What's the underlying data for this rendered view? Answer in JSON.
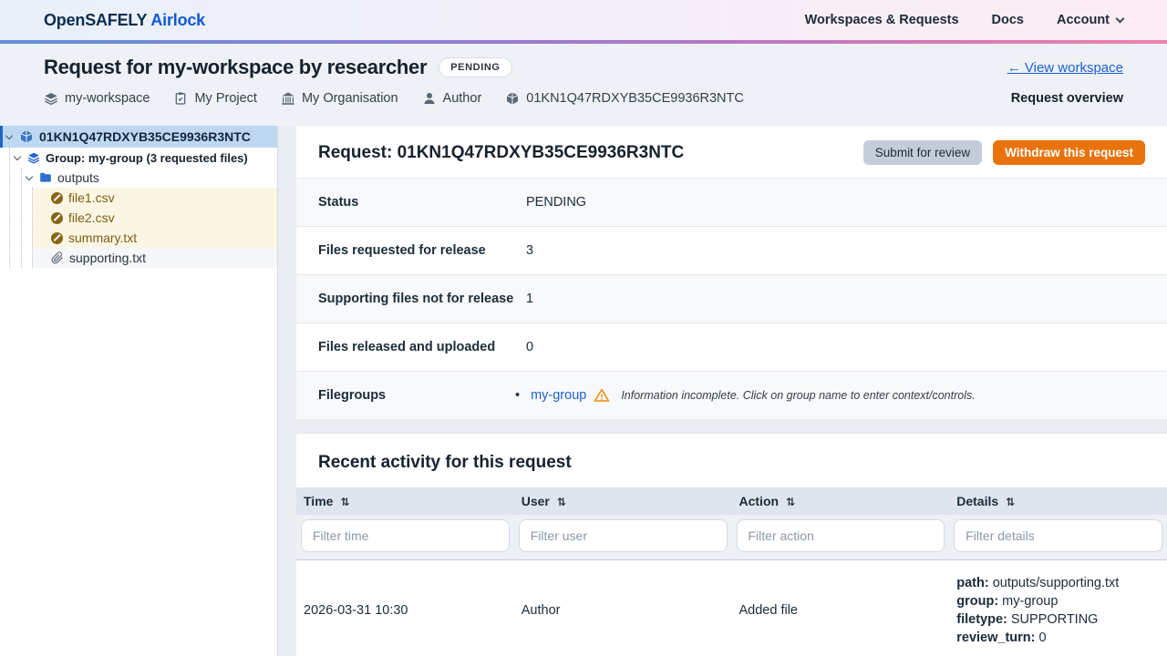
{
  "navbar": {
    "brand_primary": "OpenSAFELY",
    "brand_secondary": "Airlock",
    "nav_workspaces": "Workspaces & Requests",
    "nav_docs": "Docs",
    "nav_account": "Account"
  },
  "header": {
    "title": "Request for my-workspace by researcher",
    "status_badge": "PENDING",
    "view_workspace": "← View workspace",
    "request_overview": "Request overview",
    "meta": [
      {
        "icon": "layers-icon",
        "label": "my-workspace"
      },
      {
        "icon": "project-icon",
        "label": "My Project"
      },
      {
        "icon": "organisation-icon",
        "label": "My Organisation"
      },
      {
        "icon": "user-icon",
        "label": "Author"
      },
      {
        "icon": "request-id-icon",
        "label": "01KN1Q47RDXYB35CE9936R3NTC"
      }
    ]
  },
  "sidebar": {
    "tree": [
      {
        "label": "01KN1Q47RDXYB35CE9936R3NTC",
        "icon": "request-icon",
        "state": "selected"
      },
      {
        "label": "Group: my-group (3 requested files)",
        "icon": "group-layers-icon"
      },
      {
        "label": "outputs",
        "icon": "folder-icon"
      },
      {
        "label": "file1.csv",
        "icon": "pending-file-icon"
      },
      {
        "label": "file2.csv",
        "icon": "pending-file-icon"
      },
      {
        "label": "summary.txt",
        "icon": "pending-file-icon"
      },
      {
        "label": "supporting.txt",
        "icon": "paperclip-icon"
      }
    ]
  },
  "request": {
    "heading": "Request: 01KN1Q47RDXYB35CE9936R3NTC",
    "submit_button": "Submit for review",
    "withdraw_button": "Withdraw this request",
    "info": [
      {
        "label": "Status",
        "value": "PENDING"
      },
      {
        "label": "Files requested for release",
        "value": "3"
      },
      {
        "label": "Supporting files not for release",
        "value": "1"
      },
      {
        "label": "Files released and uploaded",
        "value": "0"
      }
    ],
    "filegroups": {
      "label": "Filegroups",
      "bullet": "•",
      "group_link": "my-group",
      "warning_icon": "warning-triangle-icon",
      "warning_text": "Information incomplete. Click on group name to enter context/controls."
    }
  },
  "activity": {
    "heading": "Recent activity for this request",
    "sort_icon": "⇅",
    "columns": [
      "Time",
      "User",
      "Action",
      "Details"
    ],
    "filters": [
      "Filter time",
      "Filter user",
      "Filter action",
      "Filter details"
    ],
    "rows": [
      {
        "time": "2026-03-31 10:30",
        "user": "Author",
        "action": "Added file",
        "details": [
          {
            "key": "path:",
            "value": "outputs/supporting.txt"
          },
          {
            "key": "group:",
            "value": "my-group"
          },
          {
            "key": "filetype:",
            "value": "SUPPORTING"
          },
          {
            "key": "review_turn:",
            "value": "0"
          }
        ]
      }
    ]
  },
  "colors": {
    "accent_blue": "#0d59d2",
    "link_blue": "#1d5fd0",
    "orange_button": "#e8730c",
    "warning_orange": "#ee8b0e",
    "selected_row": "#bed8f2",
    "pending_row": "#fbf6e3",
    "pending_text": "#7d5e14"
  }
}
